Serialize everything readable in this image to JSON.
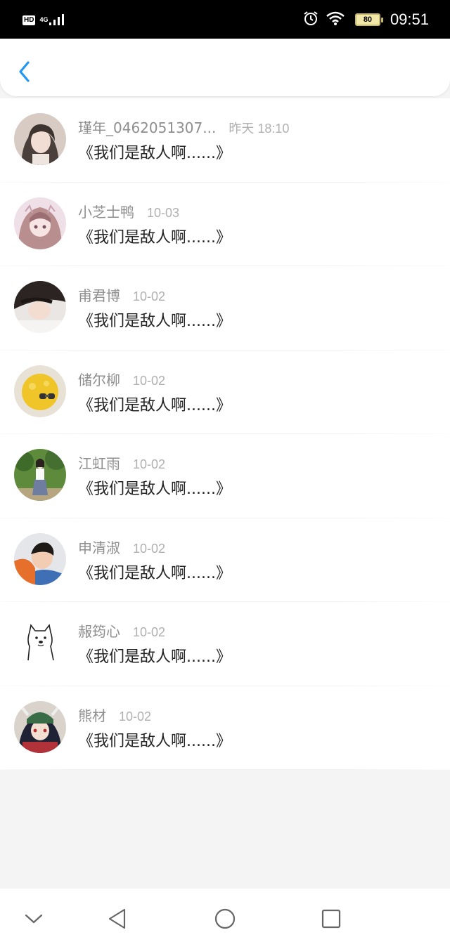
{
  "status_bar": {
    "hd": "HD",
    "network": "4G",
    "battery": "80",
    "time": "09:51",
    "icons": [
      "signal-icon",
      "alarm-icon",
      "wifi-icon",
      "battery-icon"
    ]
  },
  "header": {
    "back_icon": "chevron-left-icon",
    "accent_color": "#2196f3"
  },
  "conversations": [
    {
      "name": "瑾年_0462051307...",
      "date": "昨天 18:10",
      "message": "《我们是敌人啊......》"
    },
    {
      "name": "小芝士鸭",
      "date": "10-03",
      "message": "《我们是敌人啊......》"
    },
    {
      "name": "甫君博",
      "date": "10-02",
      "message": "《我们是敌人啊......》"
    },
    {
      "name": "储尔柳",
      "date": "10-02",
      "message": "《我们是敌人啊......》"
    },
    {
      "name": "江虹雨",
      "date": "10-02",
      "message": "《我们是敌人啊......》"
    },
    {
      "name": "申清淑",
      "date": "10-02",
      "message": "《我们是敌人啊......》"
    },
    {
      "name": "赧筠心",
      "date": "10-02",
      "message": "《我们是敌人啊......》"
    },
    {
      "name": "熊材",
      "date": "10-02",
      "message": "《我们是敌人啊......》"
    }
  ],
  "nav_bar": {
    "icons": [
      "collapse-chevron-icon",
      "back-triangle-icon",
      "home-circle-icon",
      "recents-square-icon"
    ]
  }
}
